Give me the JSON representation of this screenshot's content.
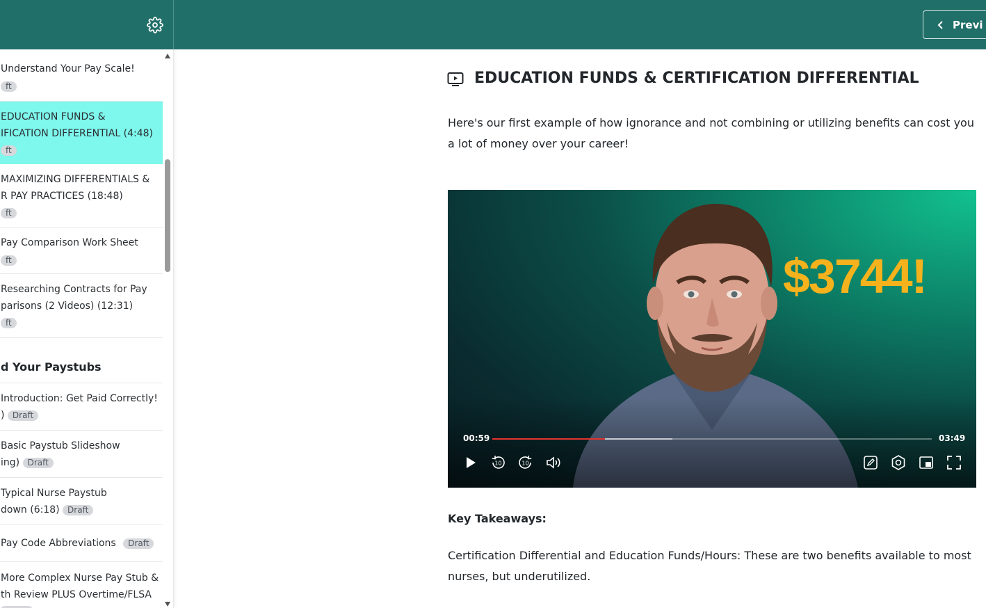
{
  "header": {
    "settings_icon": "gear-icon",
    "prev_button_label": "Previ",
    "prev_icon": "chevron-left-icon",
    "background_color": "#216f69"
  },
  "sidebar": {
    "items_top": [
      {
        "title_line1": "Understand Your Pay Scale!",
        "title_line2": "",
        "badge": "ft",
        "badge_prefix": ""
      },
      {
        "title_line1": "EDUCATION FUNDS &",
        "title_line2": "IFICATION DIFFERENTIAL (4:48)",
        "badge": "ft",
        "badge_prefix": "",
        "active": true
      },
      {
        "title_line1": "MAXIMIZING DIFFERENTIALS &",
        "title_line2": "R PAY PRACTICES (18:48)",
        "badge": "ft",
        "badge_prefix": ""
      },
      {
        "title_line1": "Pay Comparison Work Sheet",
        "title_line2": "",
        "badge": "ft",
        "badge_prefix": ""
      },
      {
        "title_line1": "Researching Contracts for Pay",
        "title_line2": "parisons (2 Videos) (12:31)",
        "badge": "ft",
        "badge_prefix": ""
      }
    ],
    "section_title": "d Your Paystubs",
    "items_bottom": [
      {
        "title_line1": "Introduction: Get Paid Correctly!",
        "title_line2": "",
        "badge_prefix": ")",
        "badge": "Draft"
      },
      {
        "title_line1": "Basic Paystub Slideshow",
        "title_line2": "",
        "badge_prefix": "ing)",
        "badge": "Draft"
      },
      {
        "title_line1": "Typical Nurse Paystub",
        "title_line2": "",
        "badge_prefix": "down (6:18)",
        "badge": "Draft"
      },
      {
        "title_line1": "Pay Code Abbreviations",
        "title_line2": "",
        "badge_prefix": "",
        "badge": "Draft"
      },
      {
        "title_line1": "More Complex Nurse Pay Stub &",
        "title_line2": "th Review PLUS Overtime/FLSA",
        "badge_prefix": "",
        "badge": ""
      }
    ],
    "active_color": "#7ef7ec"
  },
  "main": {
    "lesson_icon": "video-lesson-icon",
    "title": "EDUCATION FUNDS & CERTIFICATION DIFFERENTIAL",
    "intro": "Here's our first example of how ignorance and not combining or utilizing benefits can cost you a lot of money over your career!",
    "video": {
      "overlay_text": "$3744!",
      "current_time": "00:59",
      "duration": "03:49",
      "played_fraction": 0.257,
      "buffered_fraction": 0.41,
      "controls": [
        "play-icon",
        "rewind-10-icon",
        "forward-10-icon",
        "volume-icon",
        "notes-icon",
        "settings-icon",
        "picture-in-picture-icon",
        "fullscreen-icon"
      ]
    },
    "key_takeaways_heading": "Key Takeaways:",
    "paragraph": "Certification Differential and Education Funds/Hours: These are two benefits available to most nurses, but underutilized."
  }
}
